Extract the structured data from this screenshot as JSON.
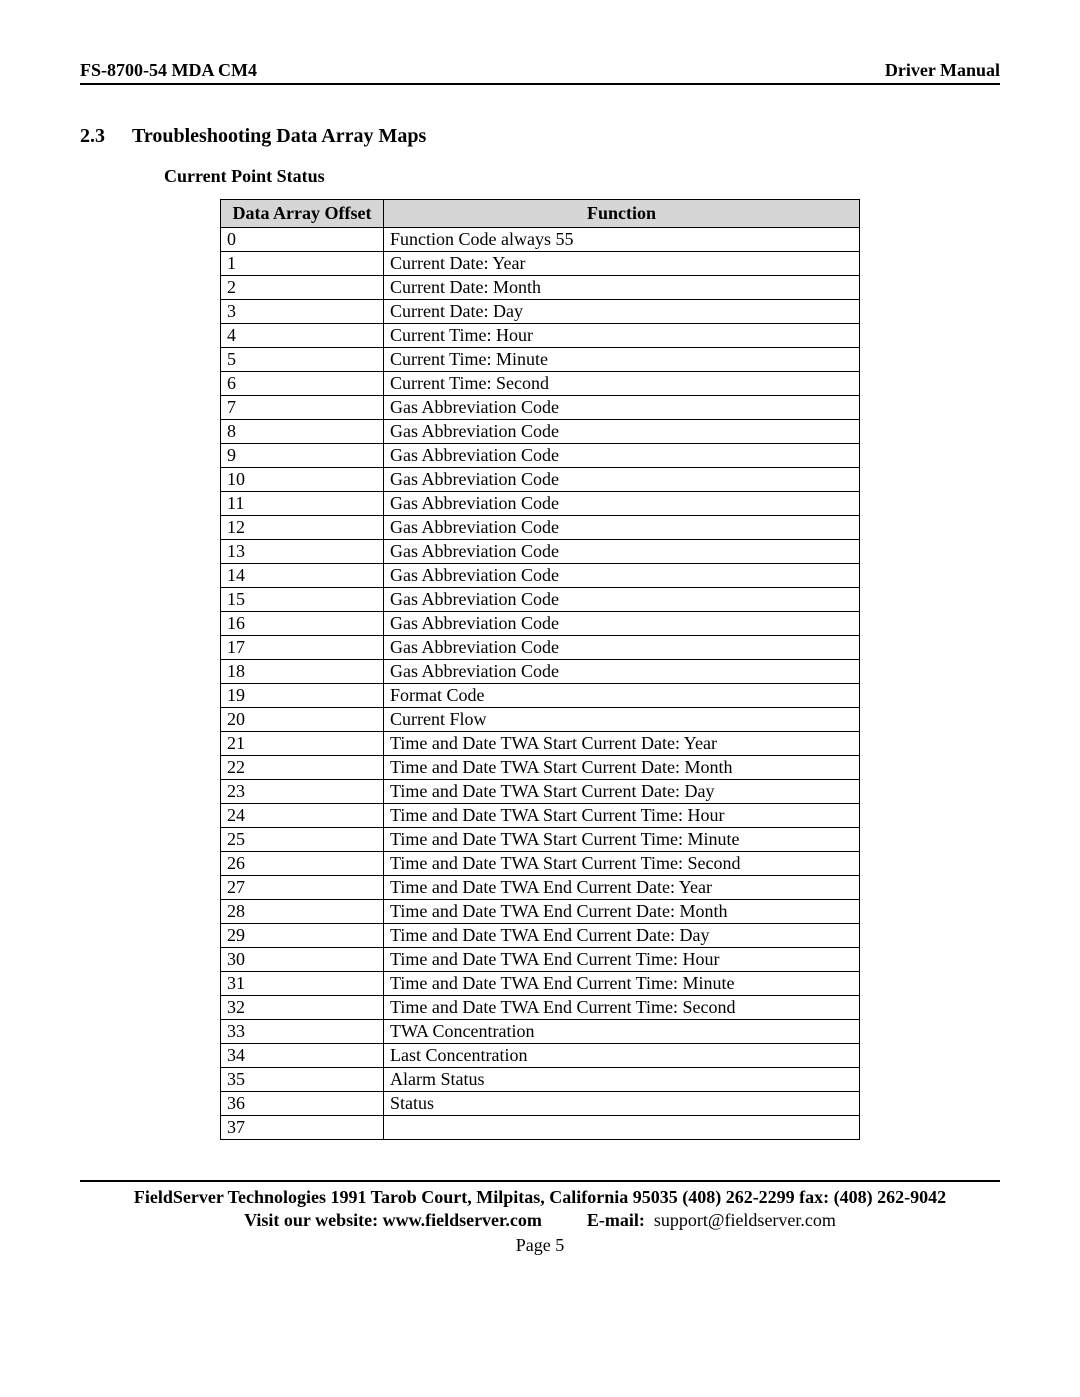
{
  "header": {
    "left": "FS-8700-54 MDA CM4",
    "right": "Driver Manual"
  },
  "section": {
    "number": "2.3",
    "title": "Troubleshooting Data Array Maps",
    "subtitle": "Current Point Status"
  },
  "table": {
    "headers": {
      "offset": "Data Array Offset",
      "function": "Function"
    },
    "rows": [
      {
        "offset": "0",
        "function": "Function Code always 55"
      },
      {
        "offset": "1",
        "function": "Current Date: Year"
      },
      {
        "offset": "2",
        "function": "Current Date: Month"
      },
      {
        "offset": "3",
        "function": "Current Date: Day"
      },
      {
        "offset": "4",
        "function": "Current Time: Hour"
      },
      {
        "offset": "5",
        "function": "Current Time: Minute"
      },
      {
        "offset": "6",
        "function": "Current Time: Second"
      },
      {
        "offset": "7",
        "function": "Gas Abbreviation Code"
      },
      {
        "offset": "8",
        "function": "Gas Abbreviation Code"
      },
      {
        "offset": "9",
        "function": "Gas Abbreviation Code"
      },
      {
        "offset": "10",
        "function": "Gas Abbreviation Code"
      },
      {
        "offset": "11",
        "function": "Gas Abbreviation Code"
      },
      {
        "offset": "12",
        "function": "Gas Abbreviation Code"
      },
      {
        "offset": "13",
        "function": "Gas Abbreviation Code"
      },
      {
        "offset": "14",
        "function": "Gas Abbreviation Code"
      },
      {
        "offset": "15",
        "function": "Gas Abbreviation Code"
      },
      {
        "offset": "16",
        "function": "Gas Abbreviation Code"
      },
      {
        "offset": "17",
        "function": "Gas Abbreviation Code"
      },
      {
        "offset": "18",
        "function": "Gas Abbreviation Code"
      },
      {
        "offset": "19",
        "function": "Format Code"
      },
      {
        "offset": "20",
        "function": "Current Flow"
      },
      {
        "offset": "21",
        "function": "Time and Date TWA Start Current Date: Year"
      },
      {
        "offset": "22",
        "function": "Time and Date TWA Start Current Date: Month"
      },
      {
        "offset": "23",
        "function": "Time and Date TWA Start Current Date: Day"
      },
      {
        "offset": "24",
        "function": "Time and Date TWA Start Current Time: Hour"
      },
      {
        "offset": "25",
        "function": "Time and Date TWA Start Current Time: Minute"
      },
      {
        "offset": "26",
        "function": "Time and Date TWA Start Current Time: Second"
      },
      {
        "offset": "27",
        "function": "Time and Date TWA End Current Date: Year"
      },
      {
        "offset": "28",
        "function": "Time and Date TWA End Current Date: Month"
      },
      {
        "offset": "29",
        "function": "Time and Date TWA End Current Date: Day"
      },
      {
        "offset": "30",
        "function": "Time and Date TWA End Current Time: Hour"
      },
      {
        "offset": "31",
        "function": "Time and Date TWA End Current Time: Minute"
      },
      {
        "offset": "32",
        "function": "Time and Date TWA End Current Time: Second"
      },
      {
        "offset": "33",
        "function": "TWA Concentration"
      },
      {
        "offset": "34",
        "function": "Last Concentration"
      },
      {
        "offset": "35",
        "function": "Alarm Status"
      },
      {
        "offset": "36",
        "function": "Status"
      },
      {
        "offset": "37",
        "function": ""
      }
    ]
  },
  "footer": {
    "address": "FieldServer Technologies 1991 Tarob Court, Milpitas, California 95035 (408) 262-2299 fax: (408) 262-9042",
    "website_label": "Visit our website: ",
    "website": "www.fieldserver.com",
    "email_label": "E-mail:",
    "email": "support@fieldserver.com",
    "page_label": "Page 5"
  }
}
